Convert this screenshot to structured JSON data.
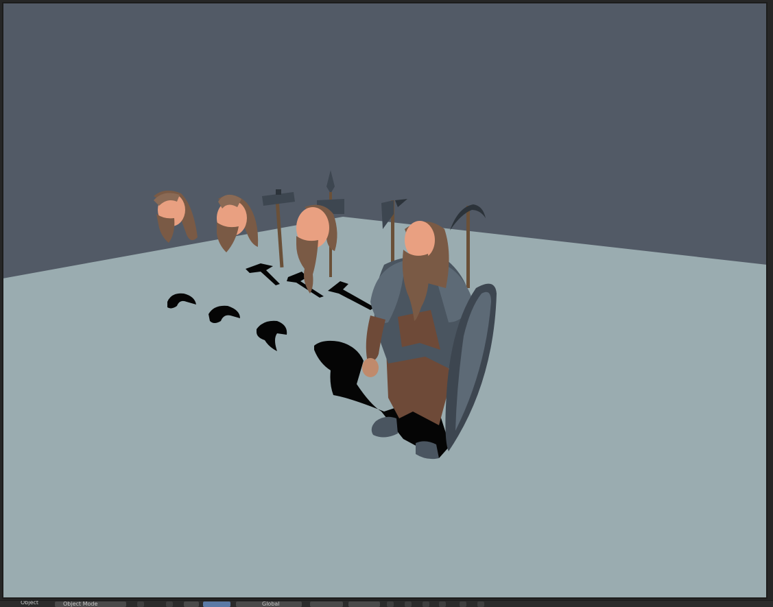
{
  "app": {
    "name": "3D Viewport"
  },
  "viewport": {
    "colors": {
      "world": "#525a66",
      "floor": "#9aacb0",
      "shadow": "#050505",
      "skin": "#e9a081",
      "hair": "#7a5a45",
      "armor": "#4a5560",
      "tunic": "#6e4a38",
      "wood": "#6a5038",
      "metal": "#3d4650"
    },
    "objects": [
      {
        "name": "head-variant-1"
      },
      {
        "name": "head-variant-2"
      },
      {
        "name": "head-variant-3"
      },
      {
        "name": "hammer-weapon"
      },
      {
        "name": "spear-weapon"
      },
      {
        "name": "axe-weapon"
      },
      {
        "name": "pickaxe-weapon"
      },
      {
        "name": "dwarf-character"
      },
      {
        "name": "shield"
      }
    ]
  },
  "header": {
    "mode_label": "Object",
    "mode_select": "Object Mode",
    "pivot_label": "Global"
  }
}
